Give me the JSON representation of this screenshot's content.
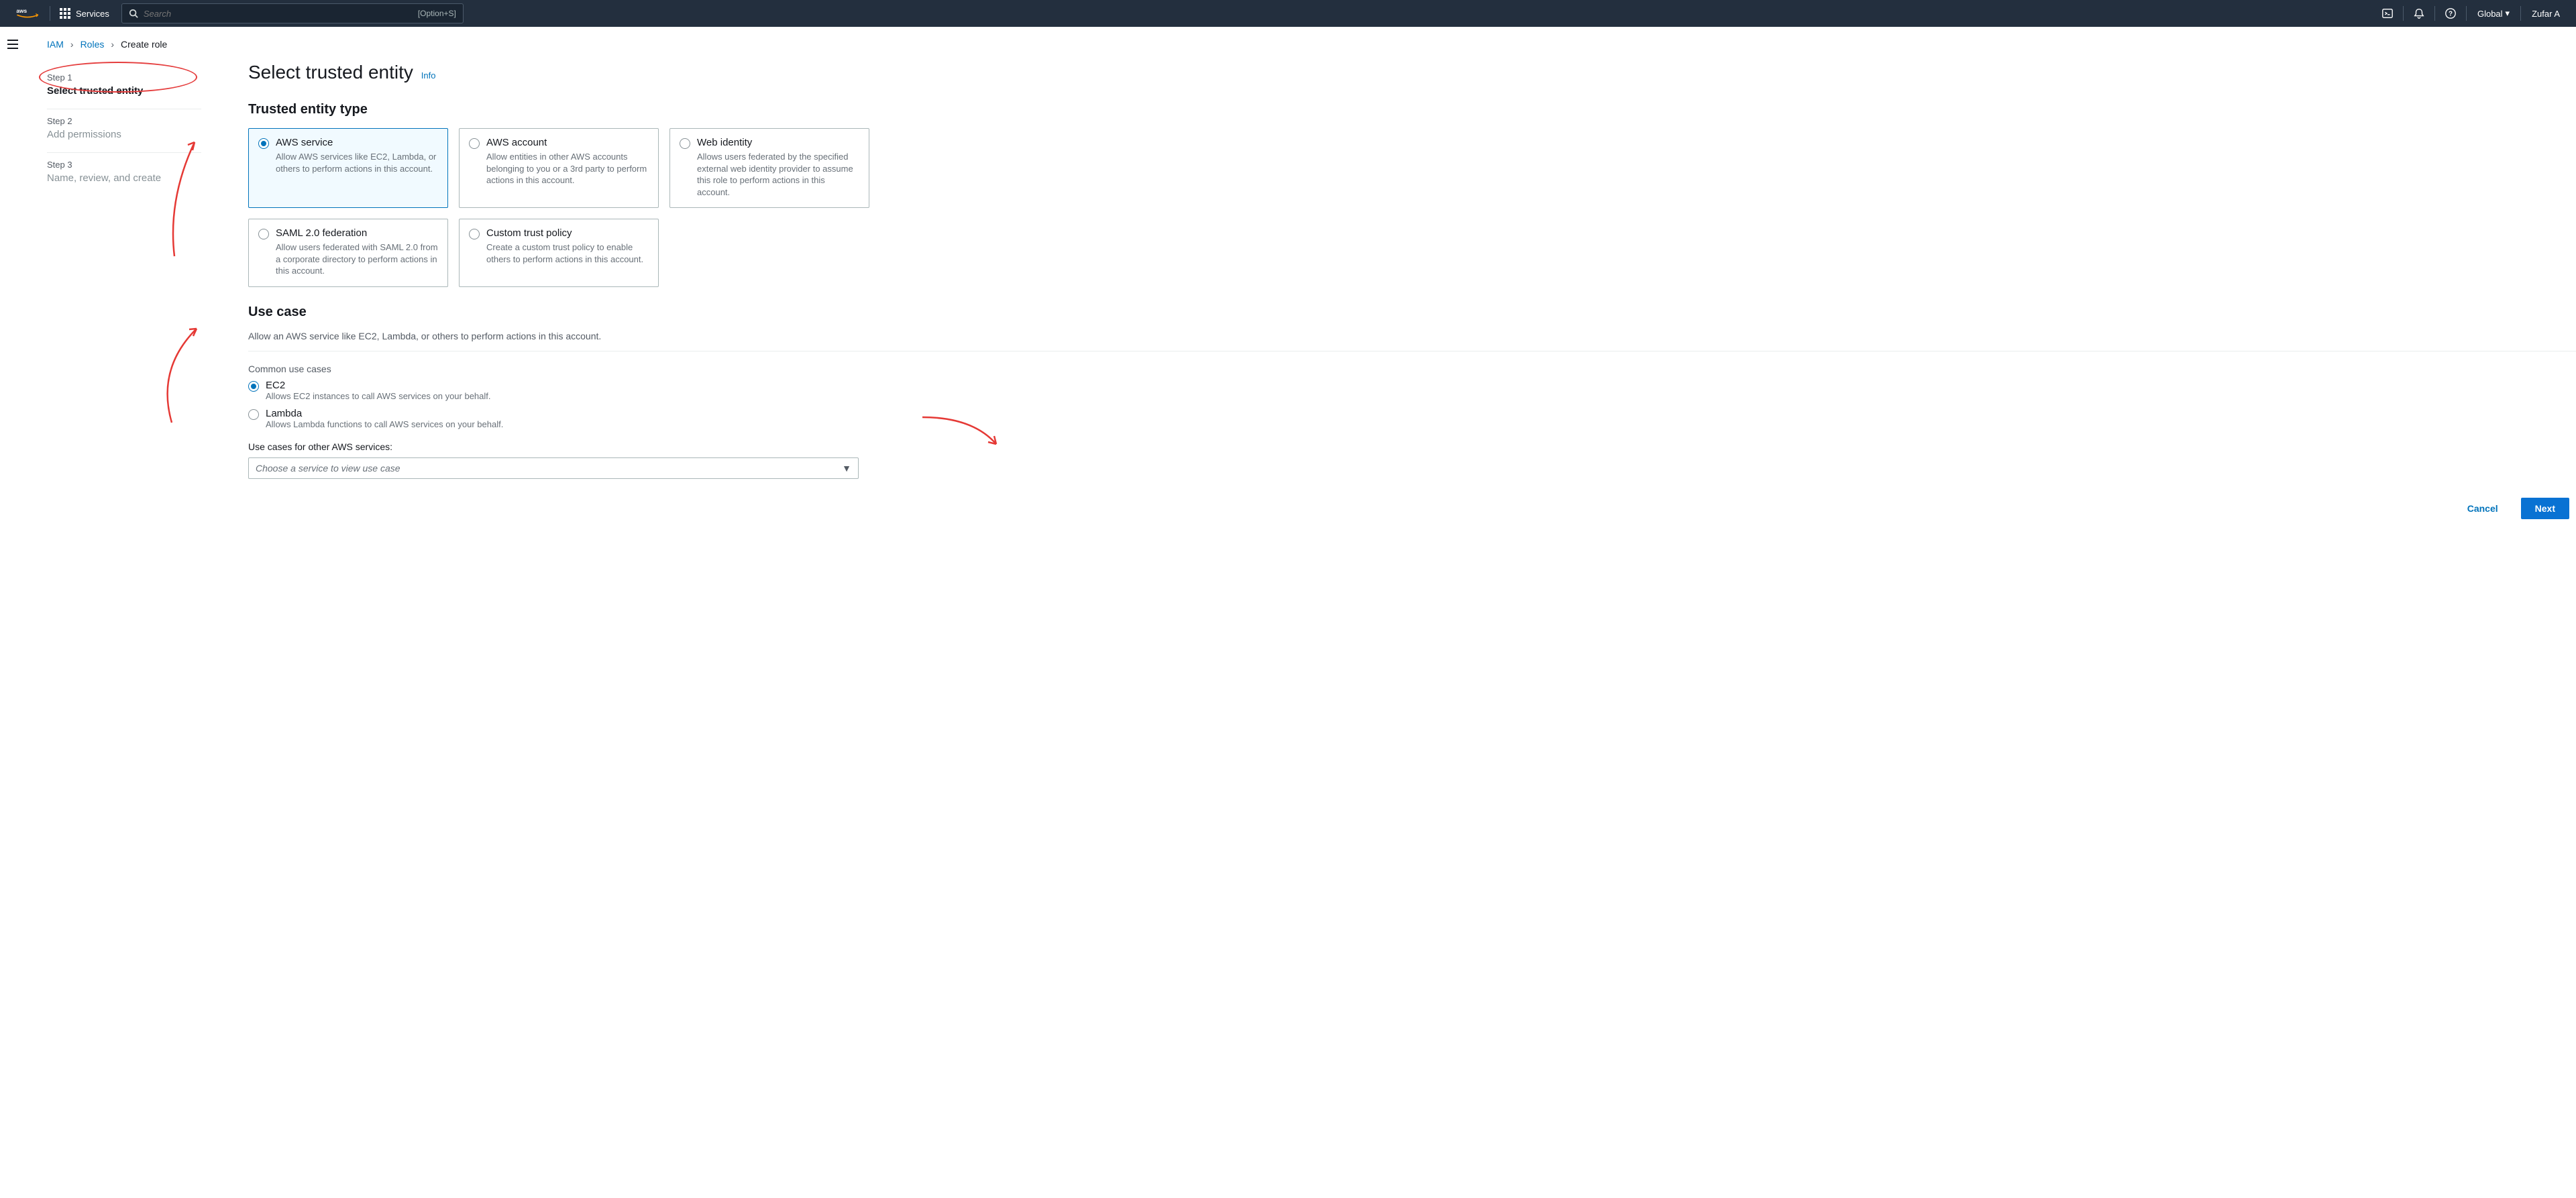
{
  "topnav": {
    "services_label": "Services",
    "search_placeholder": "Search",
    "search_shortcut": "[Option+S]",
    "region": "Global",
    "user": "Zufar A"
  },
  "breadcrumb": {
    "iam": "IAM",
    "roles": "Roles",
    "create_role": "Create role"
  },
  "steps": [
    {
      "label": "Step 1",
      "title": "Select trusted entity",
      "active": true
    },
    {
      "label": "Step 2",
      "title": "Add permissions",
      "active": false
    },
    {
      "label": "Step 3",
      "title": "Name, review, and create",
      "active": false
    }
  ],
  "page": {
    "title": "Select trusted entity",
    "info": "Info",
    "entity_section": "Trusted entity type",
    "use_case_section": "Use case",
    "use_case_help": "Allow an AWS service like EC2, Lambda, or others to perform actions in this account.",
    "common_label": "Common use cases",
    "other_label": "Use cases for other AWS services:",
    "select_placeholder": "Choose a service to view use case"
  },
  "entity_types": [
    {
      "title": "AWS service",
      "desc": "Allow AWS services like EC2, Lambda, or others to perform actions in this account.",
      "selected": true
    },
    {
      "title": "AWS account",
      "desc": "Allow entities in other AWS accounts belonging to you or a 3rd party to perform actions in this account.",
      "selected": false
    },
    {
      "title": "Web identity",
      "desc": "Allows users federated by the specified external web identity provider to assume this role to perform actions in this account.",
      "selected": false
    },
    {
      "title": "SAML 2.0 federation",
      "desc": "Allow users federated with SAML 2.0 from a corporate directory to perform actions in this account.",
      "selected": false
    },
    {
      "title": "Custom trust policy",
      "desc": "Create a custom trust policy to enable others to perform actions in this account.",
      "selected": false
    }
  ],
  "common_use_cases": [
    {
      "title": "EC2",
      "desc": "Allows EC2 instances to call AWS services on your behalf.",
      "selected": true
    },
    {
      "title": "Lambda",
      "desc": "Allows Lambda functions to call AWS services on your behalf.",
      "selected": false
    }
  ],
  "actions": {
    "cancel": "Cancel",
    "next": "Next"
  },
  "colors": {
    "accent": "#0073bb",
    "primary_btn": "#0972d3",
    "annotation": "#e53935"
  }
}
